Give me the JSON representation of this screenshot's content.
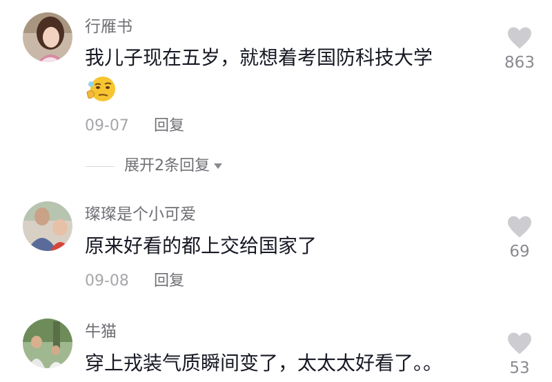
{
  "comments": [
    {
      "username": "行雁书",
      "text": "我儿子现在五岁，就想着考国防科技大学",
      "emoji": "thinking-face-emoji",
      "date": "09-07",
      "reply_label": "回复",
      "likes": "863",
      "expand_replies": "展开2条回复"
    },
    {
      "username": "璨璨是个小可爱",
      "text": "原来好看的都上交给国家了",
      "date": "09-08",
      "reply_label": "回复",
      "likes": "69"
    },
    {
      "username": "牛猫",
      "text": "穿上戎装气质瞬间变了，太太太好看了。。",
      "likes": "53"
    }
  ],
  "icons": {
    "like": "heart-icon",
    "expand": "chevron-down-icon"
  },
  "colors": {
    "username": "#6f6f75",
    "text": "#161823",
    "date": "#a6a6ab",
    "heart": "#cdcdd1"
  }
}
